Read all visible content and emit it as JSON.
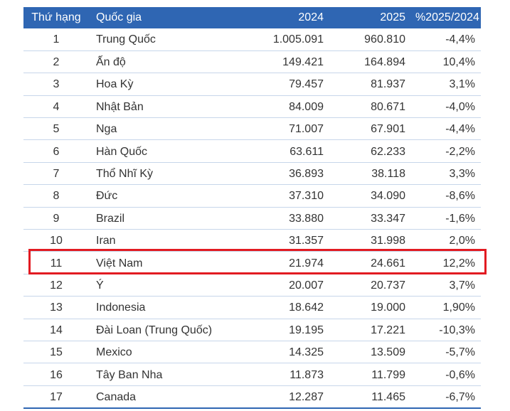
{
  "headers": {
    "rank": "Thứ hạng",
    "country": "Quốc gia",
    "y2024": "2024",
    "y2025": "2025",
    "change": "%2025/2024"
  },
  "rows": [
    {
      "rank": "1",
      "country": "Trung Quốc",
      "y2024": "1.005.091",
      "y2025": "960.810",
      "change": "-4,4%"
    },
    {
      "rank": "2",
      "country": "Ấn độ",
      "y2024": "149.421",
      "y2025": "164.894",
      "change": "10,4%"
    },
    {
      "rank": "3",
      "country": "Hoa Kỳ",
      "y2024": "79.457",
      "y2025": "81.937",
      "change": "3,1%"
    },
    {
      "rank": "4",
      "country": "Nhật Bản",
      "y2024": "84.009",
      "y2025": "80.671",
      "change": "-4,0%"
    },
    {
      "rank": "5",
      "country": "Nga",
      "y2024": "71.007",
      "y2025": "67.901",
      "change": "-4,4%"
    },
    {
      "rank": "6",
      "country": "Hàn Quốc",
      "y2024": "63.611",
      "y2025": "62.233",
      "change": "-2,2%"
    },
    {
      "rank": "7",
      "country": "Thổ Nhĩ Kỳ",
      "y2024": "36.893",
      "y2025": "38.118",
      "change": "3,3%"
    },
    {
      "rank": "8",
      "country": "Đức",
      "y2024": "37.310",
      "y2025": "34.090",
      "change": "-8,6%"
    },
    {
      "rank": "9",
      "country": "Brazil",
      "y2024": "33.880",
      "y2025": "33.347",
      "change": "-1,6%"
    },
    {
      "rank": "10",
      "country": "Iran",
      "y2024": "31.357",
      "y2025": "31.998",
      "change": "2,0%"
    },
    {
      "rank": "11",
      "country": "Việt Nam",
      "y2024": "21.974",
      "y2025": "24.661",
      "change": "12,2%"
    },
    {
      "rank": "12",
      "country": "Ý",
      "y2024": "20.007",
      "y2025": "20.737",
      "change": "3,7%"
    },
    {
      "rank": "13",
      "country": "Indonesia",
      "y2024": "18.642",
      "y2025": "19.000",
      "change": "1,90%"
    },
    {
      "rank": "14",
      "country": "Đài Loan (Trung Quốc)",
      "y2024": "19.195",
      "y2025": "17.221",
      "change": "-10,3%"
    },
    {
      "rank": "15",
      "country": "Mexico",
      "y2024": "14.325",
      "y2025": "13.509",
      "change": "-5,7%"
    },
    {
      "rank": "16",
      "country": "Tây Ban Nha",
      "y2024": "11.873",
      "y2025": "11.799",
      "change": "-0,6%"
    },
    {
      "rank": "17",
      "country": "Canada",
      "y2024": "12.287",
      "y2025": "11.465",
      "change": "-6,7%"
    }
  ],
  "colors": {
    "header_bg": "#2f66b3",
    "header_text": "#ffffff",
    "highlight": "#e21b22",
    "row_divider": "#c7d6ea"
  }
}
